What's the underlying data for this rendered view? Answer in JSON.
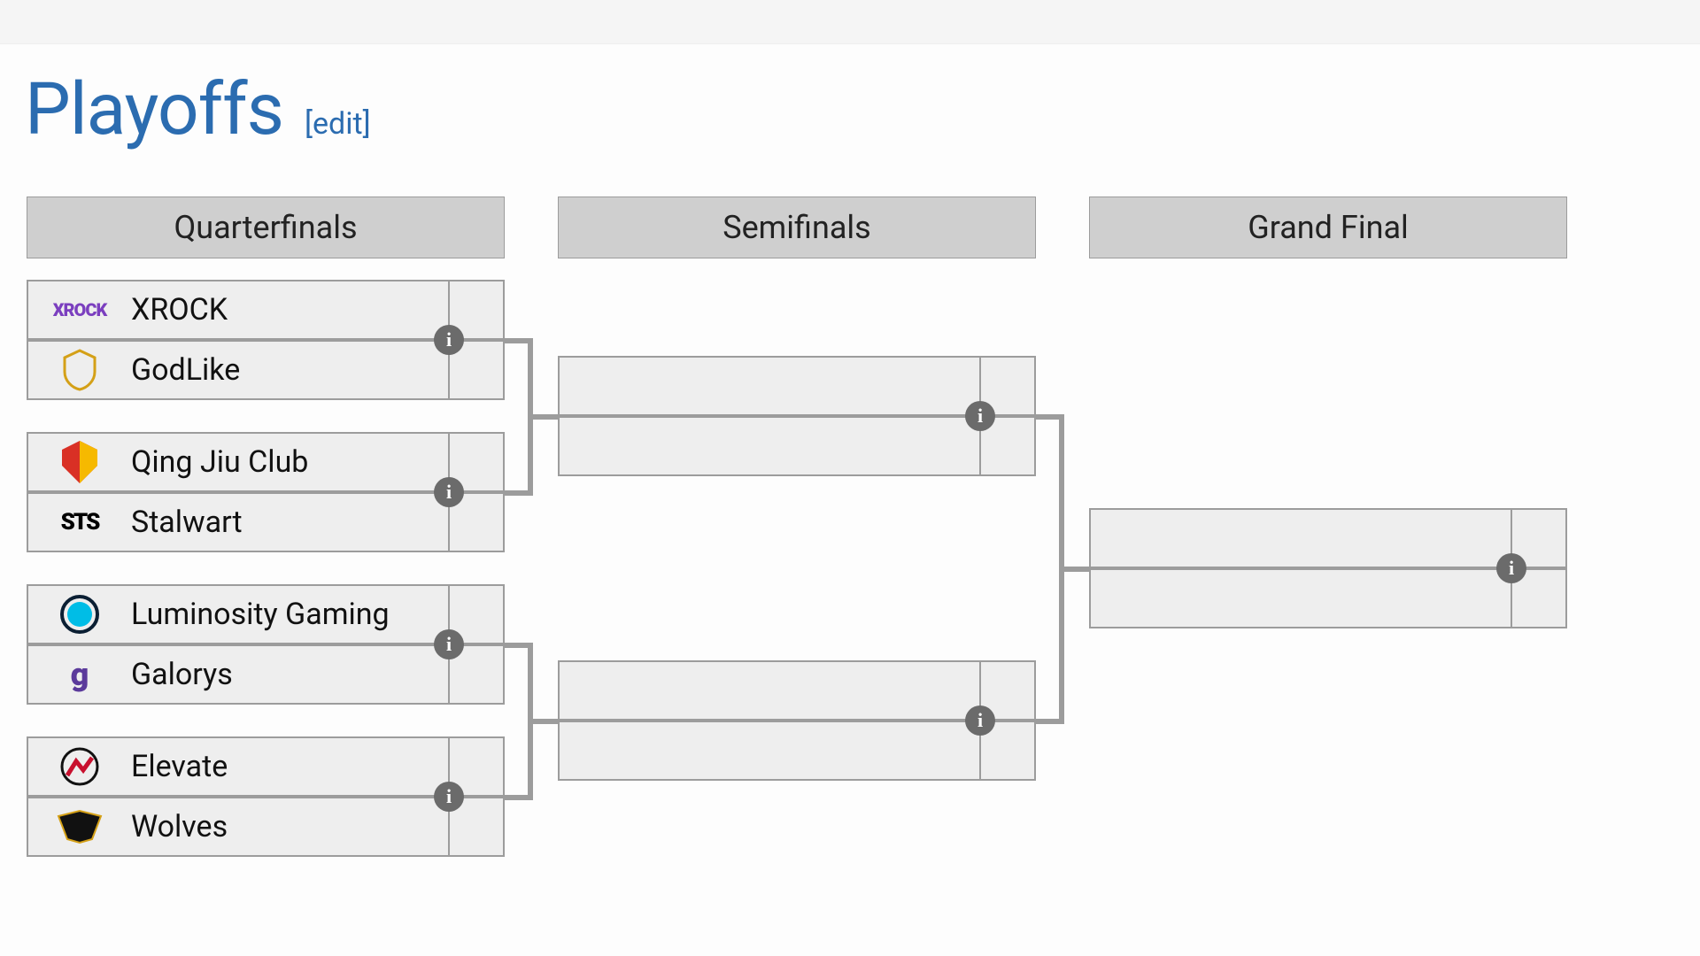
{
  "header": {
    "title": "Playoffs",
    "edit_label": "[edit]"
  },
  "rounds": {
    "qf": "Quarterfinals",
    "sf": "Semifinals",
    "gf": "Grand Final"
  },
  "matches": {
    "qf1": {
      "top": "XROCK",
      "bottom": "GodLike"
    },
    "qf2": {
      "top": "Qing Jiu Club",
      "bottom": "Stalwart"
    },
    "qf3": {
      "top": "Luminosity Gaming",
      "bottom": "Galorys"
    },
    "qf4": {
      "top": "Elevate",
      "bottom": "Wolves"
    },
    "sf1": {
      "top": "",
      "bottom": ""
    },
    "sf2": {
      "top": "",
      "bottom": ""
    },
    "gf1": {
      "top": "",
      "bottom": ""
    }
  },
  "info_glyph": "i"
}
